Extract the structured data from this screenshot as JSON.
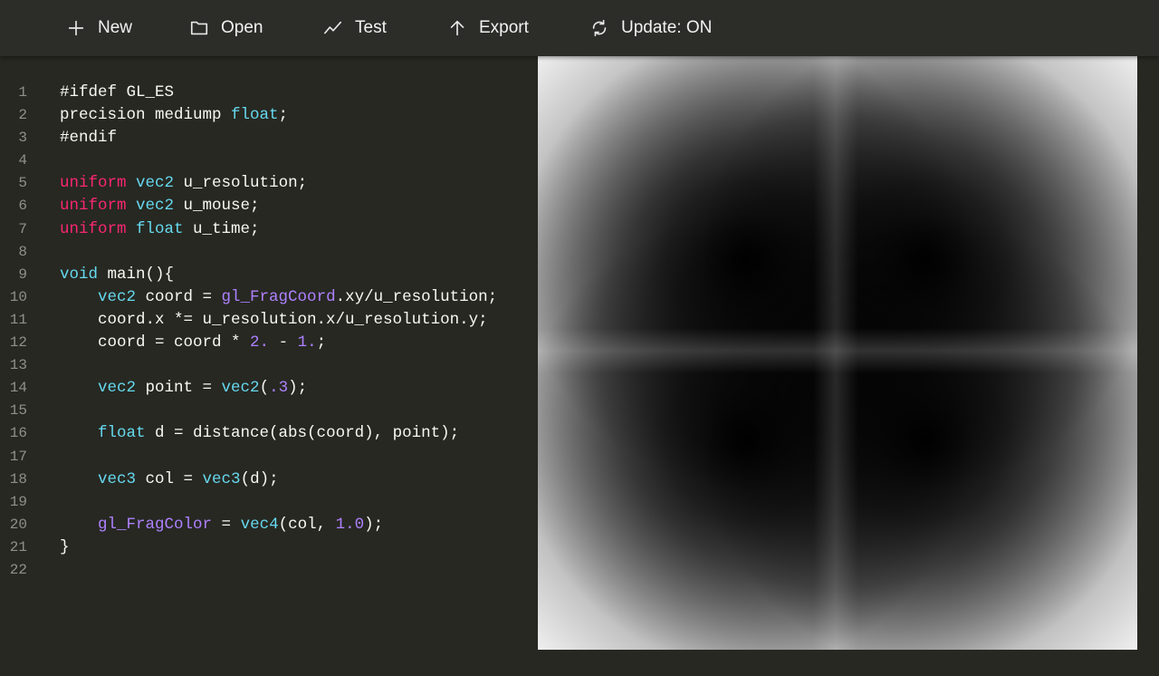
{
  "toolbar": {
    "buttons": [
      {
        "label": "New",
        "icon": "plus-icon"
      },
      {
        "label": "Open",
        "icon": "folder-icon"
      },
      {
        "label": "Test",
        "icon": "trend-line-icon"
      },
      {
        "label": "Export",
        "icon": "arrow-up-icon"
      },
      {
        "label": "Update: ON",
        "icon": "refresh-icon"
      }
    ]
  },
  "editor": {
    "line_numbers": [
      "1",
      "2",
      "3",
      "4",
      "5",
      "6",
      "7",
      "8",
      "9",
      "10",
      "11",
      "12",
      "13",
      "14",
      "15",
      "16",
      "17",
      "18",
      "19",
      "20",
      "21",
      "22"
    ],
    "lines": [
      [
        {
          "t": "#ifdef GL_ES",
          "c": ""
        }
      ],
      [
        {
          "t": "precision mediump ",
          "c": ""
        },
        {
          "t": "float",
          "c": "cyan"
        },
        {
          "t": ";",
          "c": ""
        }
      ],
      [
        {
          "t": "#endif",
          "c": ""
        }
      ],
      [],
      [
        {
          "t": "uniform",
          "c": "pink"
        },
        {
          "t": " ",
          "c": ""
        },
        {
          "t": "vec2",
          "c": "cyan"
        },
        {
          "t": " u_resolution;",
          "c": ""
        }
      ],
      [
        {
          "t": "uniform",
          "c": "pink"
        },
        {
          "t": " ",
          "c": ""
        },
        {
          "t": "vec2",
          "c": "cyan"
        },
        {
          "t": " u_mouse;",
          "c": ""
        }
      ],
      [
        {
          "t": "uniform",
          "c": "pink"
        },
        {
          "t": " ",
          "c": ""
        },
        {
          "t": "float",
          "c": "cyan"
        },
        {
          "t": " u_time;",
          "c": ""
        }
      ],
      [],
      [
        {
          "t": "void",
          "c": "cyan"
        },
        {
          "t": " main(){",
          "c": ""
        }
      ],
      [
        {
          "t": "    ",
          "c": ""
        },
        {
          "t": "vec2",
          "c": "cyan"
        },
        {
          "t": " coord = ",
          "c": ""
        },
        {
          "t": "gl_FragCoord",
          "c": "purple"
        },
        {
          "t": ".xy/u_resolution;",
          "c": ""
        }
      ],
      [
        {
          "t": "    coord.x *= u_resolution.x/u_resolution.y;",
          "c": ""
        }
      ],
      [
        {
          "t": "    coord = coord * ",
          "c": ""
        },
        {
          "t": "2.",
          "c": "purple"
        },
        {
          "t": " - ",
          "c": ""
        },
        {
          "t": "1.",
          "c": "purple"
        },
        {
          "t": ";",
          "c": ""
        }
      ],
      [],
      [
        {
          "t": "    ",
          "c": ""
        },
        {
          "t": "vec2",
          "c": "cyan"
        },
        {
          "t": " point = ",
          "c": ""
        },
        {
          "t": "vec2",
          "c": "cyan"
        },
        {
          "t": "(",
          "c": ""
        },
        {
          "t": ".3",
          "c": "purple"
        },
        {
          "t": ");",
          "c": ""
        }
      ],
      [],
      [
        {
          "t": "    ",
          "c": ""
        },
        {
          "t": "float",
          "c": "cyan"
        },
        {
          "t": " d = distance(abs(coord), point);",
          "c": ""
        }
      ],
      [],
      [
        {
          "t": "    ",
          "c": ""
        },
        {
          "t": "vec3",
          "c": "cyan"
        },
        {
          "t": " col = ",
          "c": ""
        },
        {
          "t": "vec3",
          "c": "cyan"
        },
        {
          "t": "(d);",
          "c": ""
        }
      ],
      [],
      [
        {
          "t": "    ",
          "c": ""
        },
        {
          "t": "gl_FragColor",
          "c": "purple"
        },
        {
          "t": " = ",
          "c": ""
        },
        {
          "t": "vec4",
          "c": "cyan"
        },
        {
          "t": "(col, ",
          "c": ""
        },
        {
          "t": "1.0",
          "c": "purple"
        },
        {
          "t": ");",
          "c": ""
        }
      ],
      [
        {
          "t": "}",
          "c": ""
        }
      ],
      []
    ]
  },
  "preview": {
    "shader_point": 0.3
  },
  "colors": {
    "background": "#272822",
    "toolbar": "#2c2c29",
    "keyword_pink": "#f92672",
    "type_cyan": "#66d9ef",
    "builtin_purple": "#ae81ff",
    "line_number": "#8f908a"
  }
}
